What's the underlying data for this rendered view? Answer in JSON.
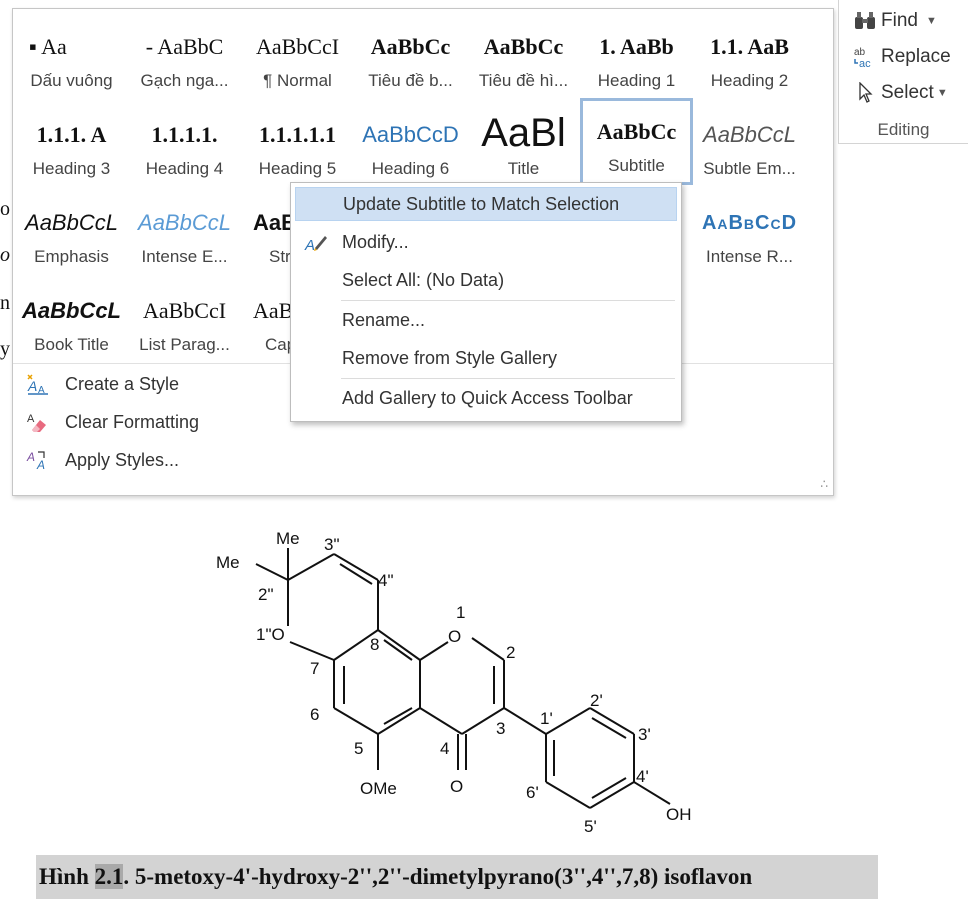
{
  "ribbon": {
    "editing": {
      "find_label": "Find",
      "replace_label": "Replace",
      "select_label": "Select",
      "group_label": "Editing"
    }
  },
  "gallery": {
    "styles": [
      {
        "sample": "▪ Aa",
        "name": "Dấu vuông"
      },
      {
        "sample": "- AaBbC",
        "name": "Gạch nga..."
      },
      {
        "sample": "AaBbCcI",
        "name": "¶ Normal"
      },
      {
        "sample": "AaBbCc",
        "name": "Tiêu đề b..."
      },
      {
        "sample": "AaBbCc",
        "name": "Tiêu đề hì..."
      },
      {
        "sample": "1. AaBb",
        "name": "Heading 1"
      },
      {
        "sample": "1.1. AaB",
        "name": "Heading 2"
      },
      {
        "sample": "1.1.1. A",
        "name": "Heading 3"
      },
      {
        "sample": "1.1.1.1.",
        "name": "Heading 4"
      },
      {
        "sample": "1.1.1.1.1",
        "name": "Heading 5"
      },
      {
        "sample": "AaBbCcD",
        "name": "Heading 6"
      },
      {
        "sample": "AaBl",
        "name": "Title"
      },
      {
        "sample": "AaBbCc",
        "name": "Subtitle"
      },
      {
        "sample": "AaBbCcL",
        "name": "Subtle Em..."
      },
      {
        "sample": "AaBbCcL",
        "name": "Emphasis"
      },
      {
        "sample": "AaBbCcL",
        "name": "Intense E..."
      },
      {
        "sample": "AaB",
        "name": "Str..."
      },
      {
        "sample": "AaBbCcD",
        "name": "Intense R..."
      },
      {
        "sample": "AaBbCcL",
        "name": "Book Title"
      },
      {
        "sample": "AaBbCcI",
        "name": "List Parag..."
      },
      {
        "sample": "AaB",
        "name": "Cap..."
      }
    ],
    "commands": {
      "create_style": "Create a Style",
      "clear_formatting": "Clear Formatting",
      "apply_styles": "Apply Styles..."
    }
  },
  "context_menu": {
    "update": "Update Subtitle to Match Selection",
    "modify": "Modify...",
    "select_all": "Select All: (No Data)",
    "rename": "Rename...",
    "remove": "Remove from Style Gallery",
    "add_gallery": "Add Gallery to Quick Access Toolbar"
  },
  "document": {
    "edge_chars": [
      "o",
      "o",
      "n",
      "y"
    ],
    "figure_labels": {
      "me_top": "Me",
      "me_left": "Me",
      "c2pp": "2\"",
      "c3pp": "3\"",
      "c4pp": "4\"",
      "o1pp": "1\"O",
      "c8": "8",
      "o1": "O",
      "n1": "1",
      "c2": "2",
      "c7": "7",
      "c6": "6",
      "c5": "5",
      "c4": "4",
      "c3": "3",
      "o4": "O",
      "ome": "OMe",
      "c1p": "1'",
      "c2p": "2'",
      "c3p": "3'",
      "c4p": "4'",
      "c5p": "5'",
      "c6p": "6'",
      "oh": "OH"
    },
    "caption": {
      "prefix": "Hình ",
      "number": "2.1",
      "text": ". 5-metoxy-4'-hydroxy-2'',2''-dimetylpyrano(3'',4'',7,8) isoflavon"
    }
  },
  "colors": {
    "selection_border": "#9ab9dc",
    "menu_highlight": "#cfe0f3",
    "heading_blue": "#2e74b5",
    "caption_bg": "#d3d3d3"
  }
}
